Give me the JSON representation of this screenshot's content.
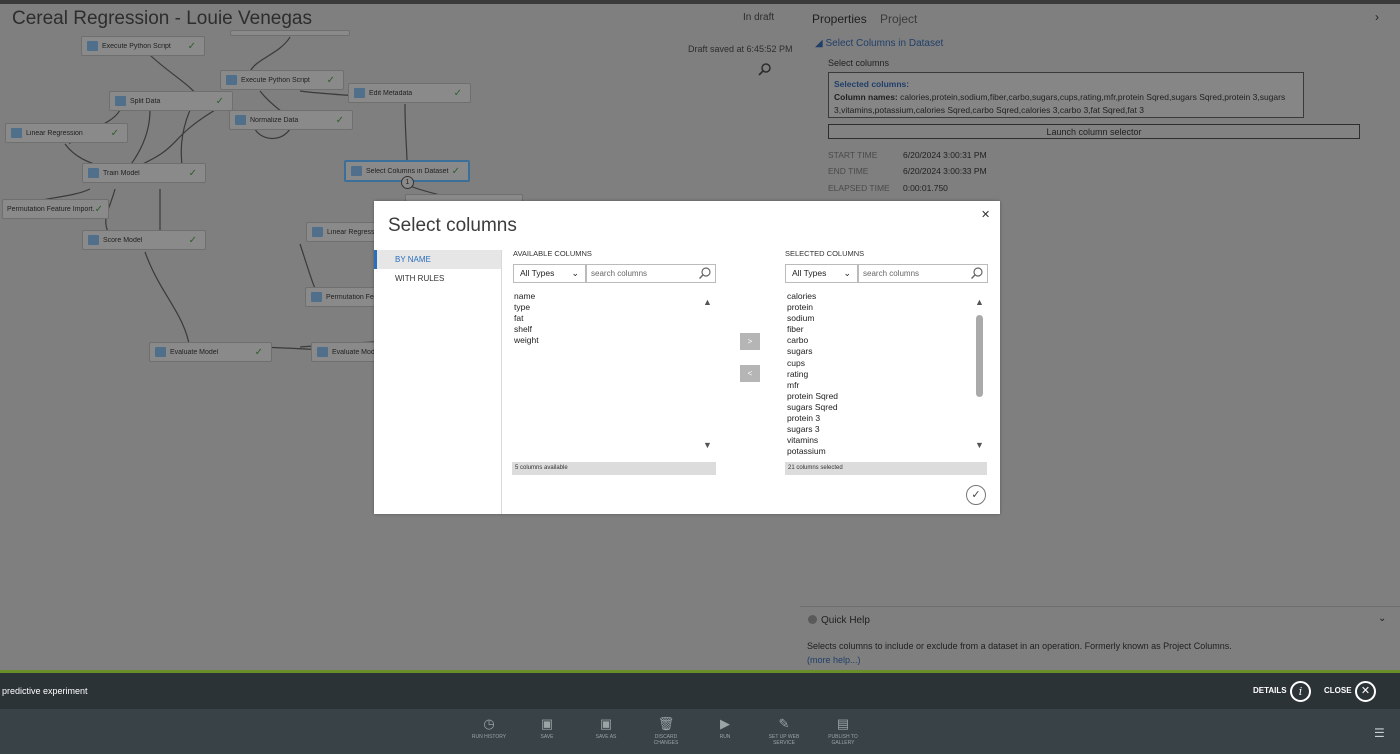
{
  "experiment": {
    "title": "Cereal Regression - Louie Venegas",
    "status": "In draft",
    "draft_saved": "Draft saved at 6:45:52 PM"
  },
  "canvas": {
    "nodes": [
      {
        "label": "Execute Python Script"
      },
      {
        "label": "Execute Python Script"
      },
      {
        "label": "Split Data"
      },
      {
        "label": "Edit Metadata"
      },
      {
        "label": "Linear Regression"
      },
      {
        "label": "Normalize Data"
      },
      {
        "label": "Train Model"
      },
      {
        "label": "Select Columns in Dataset"
      },
      {
        "label": "Permutation Feature Import..."
      },
      {
        "label": "Linear Regression"
      },
      {
        "label": "Score Model"
      },
      {
        "label": "Permutation Feature..."
      },
      {
        "label": "Evaluate Model"
      },
      {
        "label": "Evaluate Model"
      }
    ],
    "port_badge": "1"
  },
  "properties": {
    "tabs": [
      "Properties",
      "Project"
    ],
    "section_title": "Select Columns in Dataset",
    "select_columns_label": "Select columns",
    "selected_columns_heading": "Selected columns:",
    "column_names_label": "Column names:",
    "column_names_value": "calories,protein,sodium,fiber,carbo,sugars,cups,rating,mfr,protein Sqred,sugars Sqred,protein 3,sugars 3,vitamins,potassium,calories Sqred,carbo Sqred,calories 3,carbo 3,fat Sqred,fat 3",
    "launch_button": "Launch column selector",
    "meta": [
      {
        "key": "START TIME",
        "value": "6/20/2024 3:00:31 PM"
      },
      {
        "key": "END TIME",
        "value": "6/20/2024 3:00:33 PM"
      },
      {
        "key": "ELAPSED TIME",
        "value": "0:00:01.750"
      }
    ]
  },
  "quick_help": {
    "title": "Quick Help",
    "text": "Selects columns to include or exclude from a dataset in an operation. Formerly known as Project Columns.",
    "more": "(more help...)"
  },
  "infobar": {
    "label": "predictive experiment",
    "details": "DETAILS",
    "close": "CLOSE"
  },
  "commands": [
    {
      "label": "RUN HISTORY",
      "icon": "clock-icon"
    },
    {
      "label": "SAVE",
      "icon": "save-icon"
    },
    {
      "label": "SAVE AS",
      "icon": "save-as-icon"
    },
    {
      "label": "DISCARD CHANGES",
      "icon": "trash-icon"
    },
    {
      "label": "RUN",
      "icon": "play-icon"
    },
    {
      "label": "SET UP WEB SERVICE",
      "icon": "web-service-icon"
    },
    {
      "label": "PUBLISH TO GALLERY",
      "icon": "gallery-icon"
    }
  ],
  "modal": {
    "title": "Select columns",
    "nav": [
      "BY NAME",
      "WITH RULES"
    ],
    "available": {
      "heading": "AVAILABLE COLUMNS",
      "type_value": "All Types",
      "search_placeholder": "search columns",
      "items": [
        "name",
        "type",
        "fat",
        "shelf",
        "weight"
      ],
      "footer": "5 columns available"
    },
    "selected": {
      "heading": "SELECTED COLUMNS",
      "type_value": "All Types",
      "search_placeholder": "search columns",
      "items": [
        "calories",
        "protein",
        "sodium",
        "fiber",
        "carbo",
        "sugars",
        "cups",
        "rating",
        "mfr",
        "protein Sqred",
        "sugars Sqred",
        "protein 3",
        "sugars 3",
        "vitamins",
        "potassium"
      ],
      "footer": "21 columns selected"
    },
    "add_button": ">",
    "remove_button": "<"
  }
}
